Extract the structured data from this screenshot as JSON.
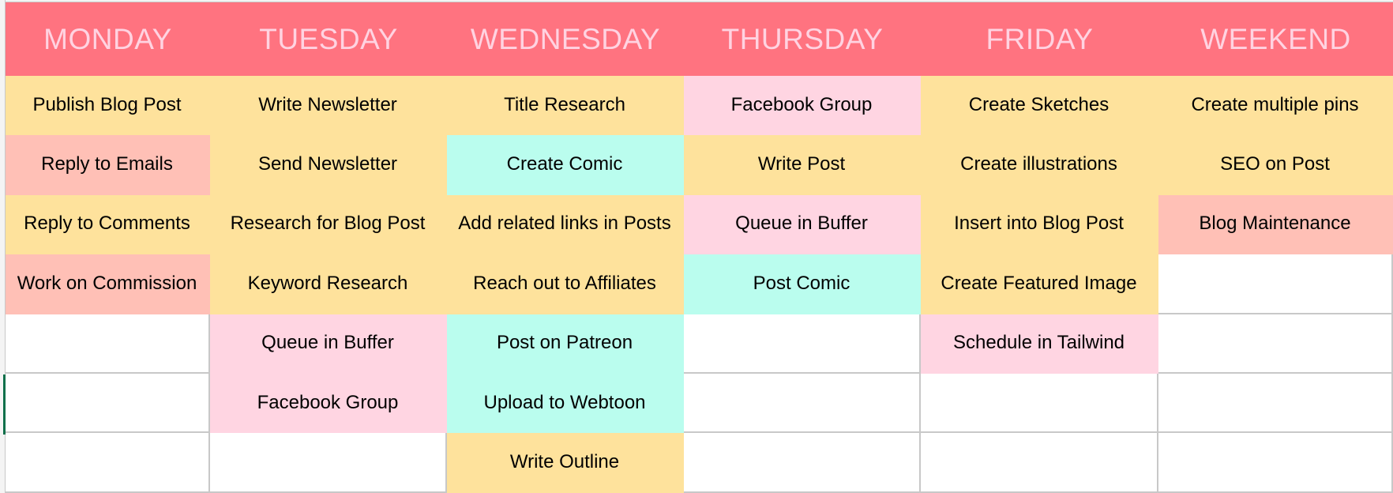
{
  "colors": {
    "header_bg": "#FF7380",
    "header_text": "#FFD3E1",
    "yellow": "#FEE29C",
    "salmon": "#FFC0B6",
    "pink": "#FFD5E2",
    "mint": "#BAFDEE",
    "gridline": "#C8C8C8",
    "selection": "#0C6F4A"
  },
  "columns": [
    {
      "day": "MONDAY",
      "tasks": [
        {
          "text": "Publish Blog Post",
          "color": "yellow"
        },
        {
          "text": "Reply to Emails",
          "color": "salmon"
        },
        {
          "text": "Reply to Comments",
          "color": "yellow"
        },
        {
          "text": "Work on Commission",
          "color": "salmon"
        },
        {
          "text": "",
          "color": "empty"
        },
        {
          "text": "",
          "color": "empty"
        },
        {
          "text": "",
          "color": "empty"
        }
      ]
    },
    {
      "day": "TUESDAY",
      "tasks": [
        {
          "text": "Write Newsletter",
          "color": "yellow"
        },
        {
          "text": "Send Newsletter",
          "color": "yellow"
        },
        {
          "text": "Research for Blog Post",
          "color": "yellow"
        },
        {
          "text": "Keyword Research",
          "color": "yellow"
        },
        {
          "text": "Queue in Buffer",
          "color": "pink"
        },
        {
          "text": "Facebook Group",
          "color": "pink"
        },
        {
          "text": "",
          "color": "empty"
        }
      ]
    },
    {
      "day": "WEDNESDAY",
      "tasks": [
        {
          "text": "Title Research",
          "color": "yellow"
        },
        {
          "text": "Create Comic",
          "color": "mint"
        },
        {
          "text": "Add related links in Posts",
          "color": "yellow"
        },
        {
          "text": "Reach out to Affiliates",
          "color": "yellow"
        },
        {
          "text": "Post on Patreon",
          "color": "mint"
        },
        {
          "text": "Upload to Webtoon",
          "color": "mint"
        },
        {
          "text": "Write Outline",
          "color": "yellow"
        }
      ]
    },
    {
      "day": "THURSDAY",
      "tasks": [
        {
          "text": "Facebook Group",
          "color": "pink"
        },
        {
          "text": "Write Post",
          "color": "yellow"
        },
        {
          "text": "Queue in Buffer",
          "color": "pink"
        },
        {
          "text": "Post Comic",
          "color": "mint"
        },
        {
          "text": "",
          "color": "empty"
        },
        {
          "text": "",
          "color": "empty"
        },
        {
          "text": "",
          "color": "empty"
        }
      ]
    },
    {
      "day": "FRIDAY",
      "tasks": [
        {
          "text": "Create Sketches",
          "color": "yellow"
        },
        {
          "text": "Create illustrations",
          "color": "yellow"
        },
        {
          "text": "Insert into Blog Post",
          "color": "yellow"
        },
        {
          "text": "Create Featured Image",
          "color": "yellow"
        },
        {
          "text": "Schedule in Tailwind",
          "color": "pink"
        },
        {
          "text": "",
          "color": "empty"
        },
        {
          "text": "",
          "color": "empty"
        }
      ]
    },
    {
      "day": "WEEKEND",
      "tasks": [
        {
          "text": "Create multiple pins",
          "color": "yellow"
        },
        {
          "text": "SEO on Post",
          "color": "yellow"
        },
        {
          "text": "Blog Maintenance",
          "color": "salmon"
        },
        {
          "text": "",
          "color": "empty"
        },
        {
          "text": "",
          "color": "empty"
        },
        {
          "text": "",
          "color": "empty"
        },
        {
          "text": "",
          "color": "empty"
        }
      ]
    }
  ]
}
